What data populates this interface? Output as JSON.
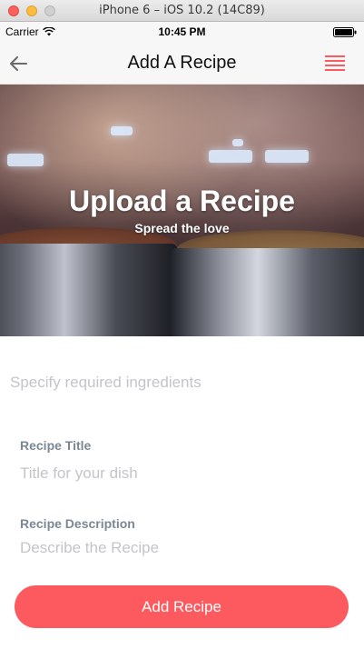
{
  "window": {
    "title": "iPhone 6 – iOS 10.2 (14C89)"
  },
  "status_bar": {
    "carrier": "Carrier",
    "time": "10:45 PM"
  },
  "nav": {
    "title": "Add A Recipe",
    "back_icon": "back-arrow-icon",
    "menu_icon": "hamburger-menu-icon",
    "accent_color": "#fd5a5f"
  },
  "hero": {
    "title": "Upload a Recipe",
    "subtitle": "Spread the love"
  },
  "form": {
    "ingredients_placeholder": "Specify required ingredients",
    "title_label": "Recipe Title",
    "title_placeholder": "Title for your dish",
    "description_label": "Recipe Description",
    "description_placeholder": "Describe the Recipe",
    "submit_label": "Add Recipe",
    "submit_color": "#fd5a5f"
  }
}
